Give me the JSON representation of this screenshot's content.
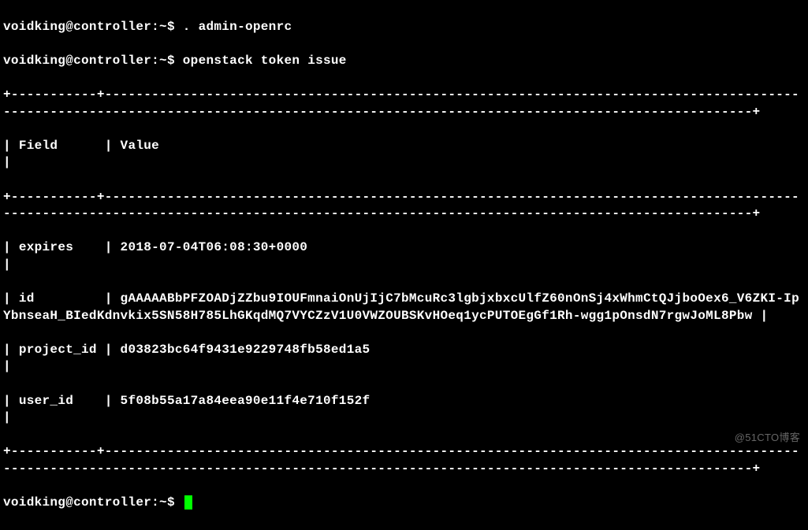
{
  "prompt": {
    "user": "voidking",
    "host": "controller",
    "path": "~",
    "symbol": "$"
  },
  "commands": {
    "cmd1": ". admin-openrc",
    "cmd2": "openstack token issue"
  },
  "table": {
    "border_top": "+-----------+-----------------------------------------------------------------------------------------------------------------------------------------------------------------------------------------+",
    "header": {
      "field_label": "Field",
      "value_label": "Value"
    },
    "rows": {
      "expires": {
        "field": "expires",
        "value": "2018-07-04T06:08:30+0000"
      },
      "id": {
        "field": "id",
        "value": "gAAAAABbPFZOADjZZbu9IOUFmnaiOnUjIjC7bMcuRc3lgbjxbxcUlfZ60nOnSj4xWhmCtQJjboOex6_V6ZKI-IpYbnseaH_BIedKdnvkix5SN58H785LhGKqdMQ7VYCZzV1U0VWZOUBSKvHOeq1ycPUTOEgGf1Rh-wgg1pOnsdN7rgwJoML8Pbw"
      },
      "project_id": {
        "field": "project_id",
        "value": "d03823bc64f9431e9229748fb58ed1a5"
      },
      "user_id": {
        "field": "user_id",
        "value": "5f08b55a17a84eea90e11f4e710f152f"
      }
    }
  },
  "watermark": "@51CTO博客"
}
